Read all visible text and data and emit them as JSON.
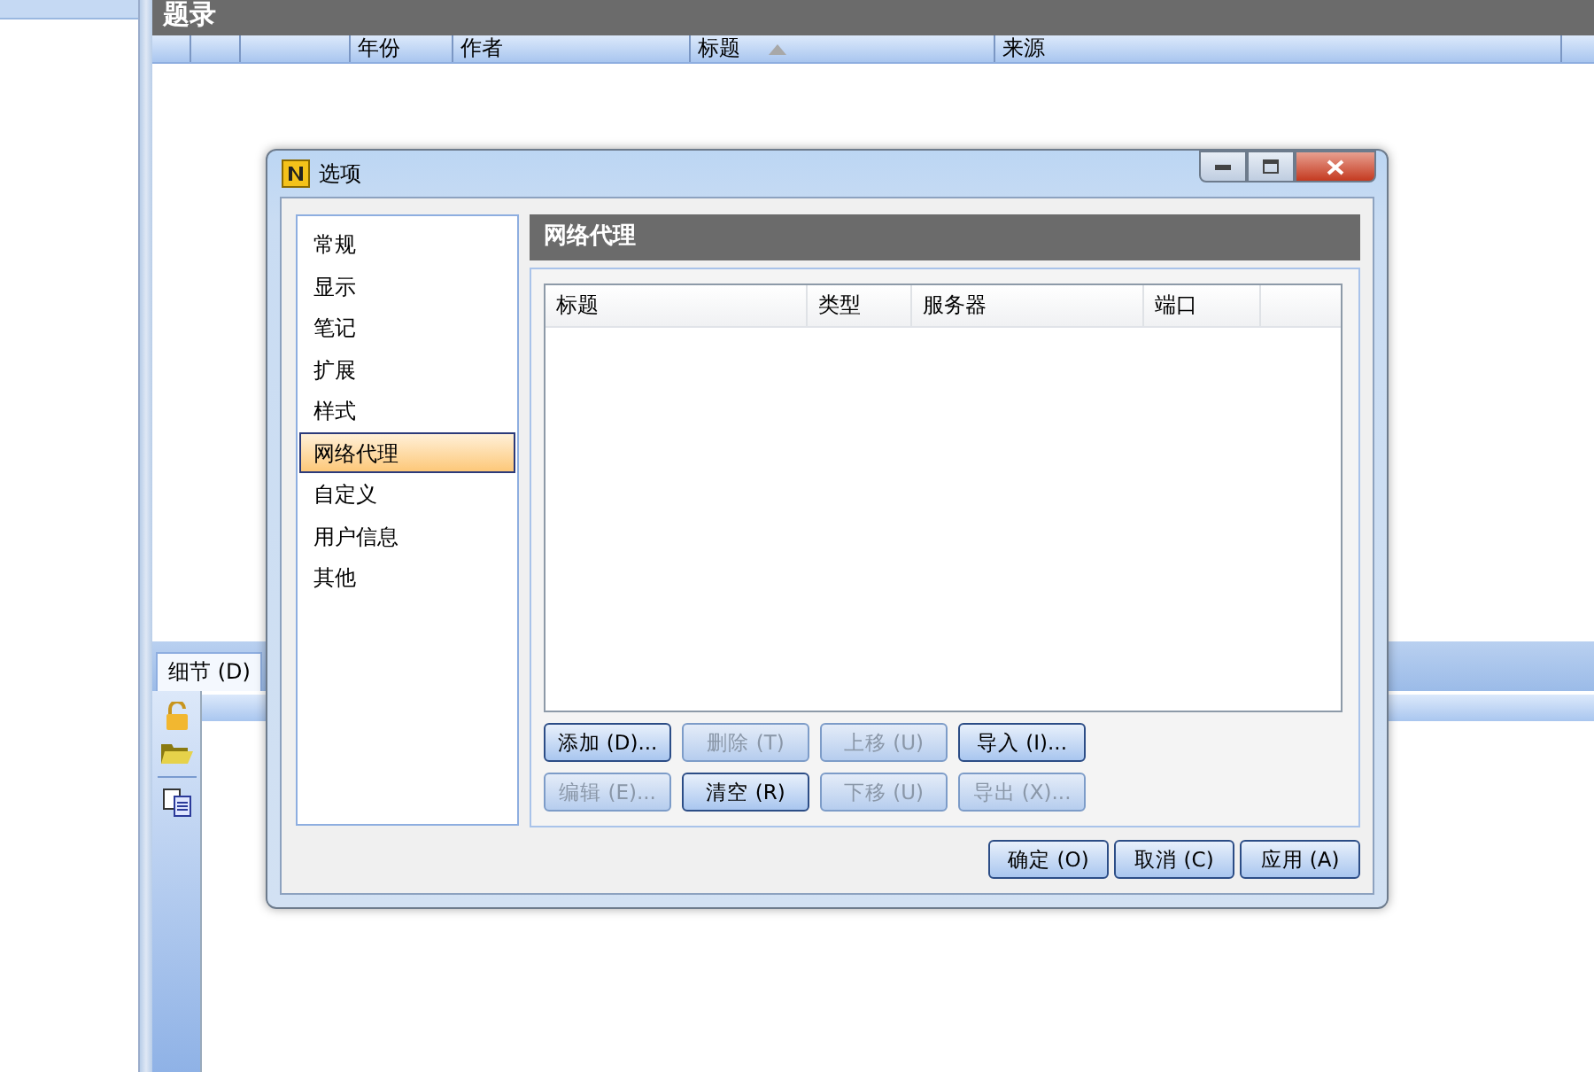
{
  "main": {
    "title": "题录",
    "columns": [
      {},
      {},
      {},
      {
        "label": "年份"
      },
      {
        "label": "作者"
      },
      {
        "label": "标题",
        "sorted": true
      },
      {
        "label": "来源"
      }
    ]
  },
  "bottom_pane": {
    "tabs": [
      {
        "label": "细节 (D)",
        "selected": true
      }
    ]
  },
  "dialog": {
    "title": "选项",
    "categories": [
      {
        "label": "常规",
        "selected": false
      },
      {
        "label": "显示",
        "selected": false
      },
      {
        "label": "笔记",
        "selected": false
      },
      {
        "label": "扩展",
        "selected": false
      },
      {
        "label": "样式",
        "selected": false
      },
      {
        "label": "网络代理",
        "selected": true
      },
      {
        "label": "自定义",
        "selected": false
      },
      {
        "label": "用户信息",
        "selected": false
      },
      {
        "label": "其他",
        "selected": false
      }
    ],
    "section_title": "网络代理",
    "table_columns": [
      "标题",
      "类型",
      "服务器",
      "端口"
    ],
    "button_rows": [
      [
        {
          "label": "添加 (D)...",
          "disabled": false
        },
        {
          "label": "删除 (T)",
          "disabled": true
        },
        {
          "label": "上移 (U)",
          "disabled": true
        },
        {
          "label": "导入 (I)...",
          "disabled": false
        }
      ],
      [
        {
          "label": "编辑 (E)...",
          "disabled": true
        },
        {
          "label": "清空 (R)",
          "disabled": false
        },
        {
          "label": "下移 (U)",
          "disabled": true
        },
        {
          "label": "导出 (X)...",
          "disabled": true
        }
      ]
    ],
    "footer_buttons": [
      {
        "label": "确定 (O)"
      },
      {
        "label": "取消 (C)"
      },
      {
        "label": "应用 (A)"
      }
    ]
  }
}
